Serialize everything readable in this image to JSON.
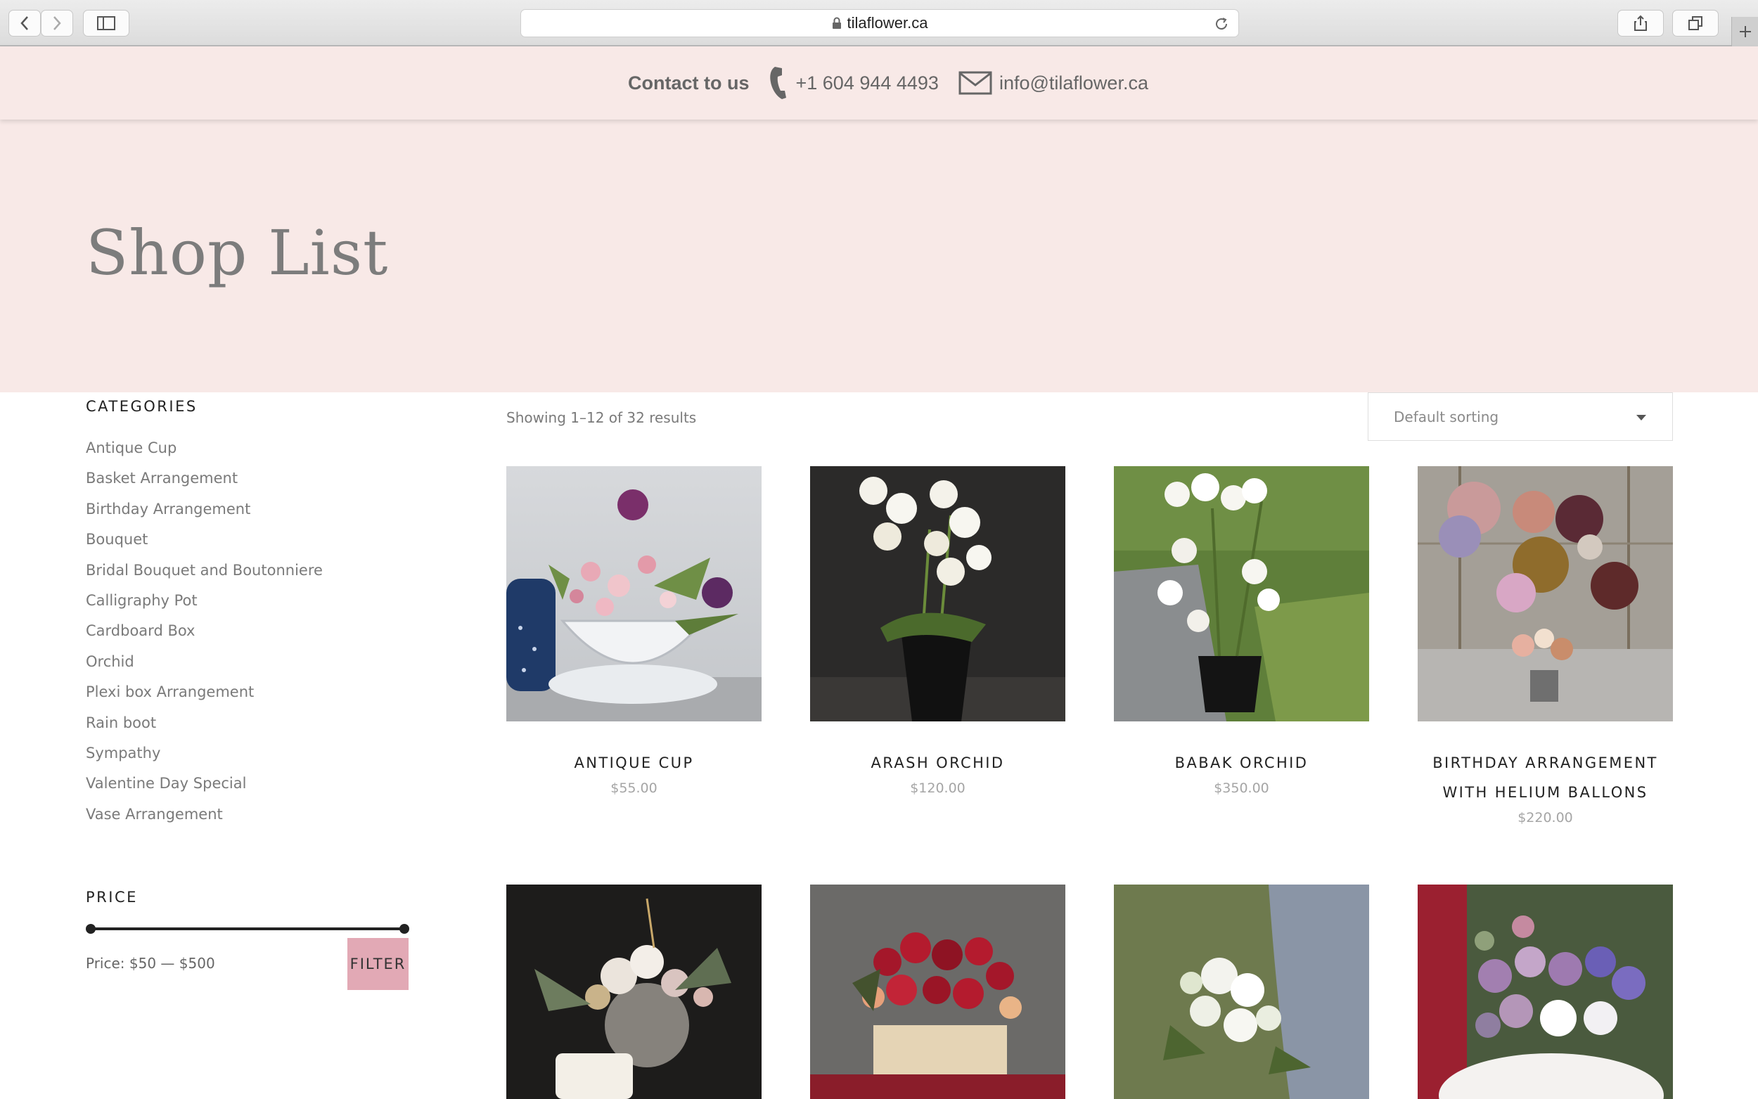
{
  "browser": {
    "url": "tilaflower.ca"
  },
  "contact": {
    "label": "Contact to us",
    "phone": "+1 604 944 4493",
    "email": "info@tilaflower.ca"
  },
  "hero": {
    "title": "Shop List"
  },
  "sidebar": {
    "categories_heading": "CATEGORIES",
    "categories": [
      "Antique Cup",
      "Basket Arrangement",
      "Birthday Arrangement",
      "Bouquet",
      "Bridal Bouquet and Boutonniere",
      "Calligraphy Pot",
      "Cardboard Box",
      "Orchid",
      "Plexi box Arrangement",
      "Rain boot",
      "Sympathy",
      "Valentine Day Special",
      "Vase Arrangement"
    ],
    "price_heading": "PRICE",
    "price_range_min": 50,
    "price_range_max": 500,
    "price_text": "Price: $50 — $500",
    "filter_label": "FILTER"
  },
  "shop": {
    "result_count": "Showing 1–12 of 32 results",
    "sort_value": "Default sorting",
    "products": [
      {
        "name": "ANTIQUE CUP",
        "price": "$55.00"
      },
      {
        "name": "ARASH ORCHID",
        "price": "$120.00"
      },
      {
        "name": "BABAK ORCHID",
        "price": "$350.00"
      },
      {
        "name": "BIRTHDAY ARRANGEMENT WITH HELIUM BALLONS",
        "price": "$220.00"
      }
    ]
  },
  "colors": {
    "hero_bg": "#f8e9e7",
    "filter_button": "#e2a9b5",
    "heading_text": "#222222"
  }
}
